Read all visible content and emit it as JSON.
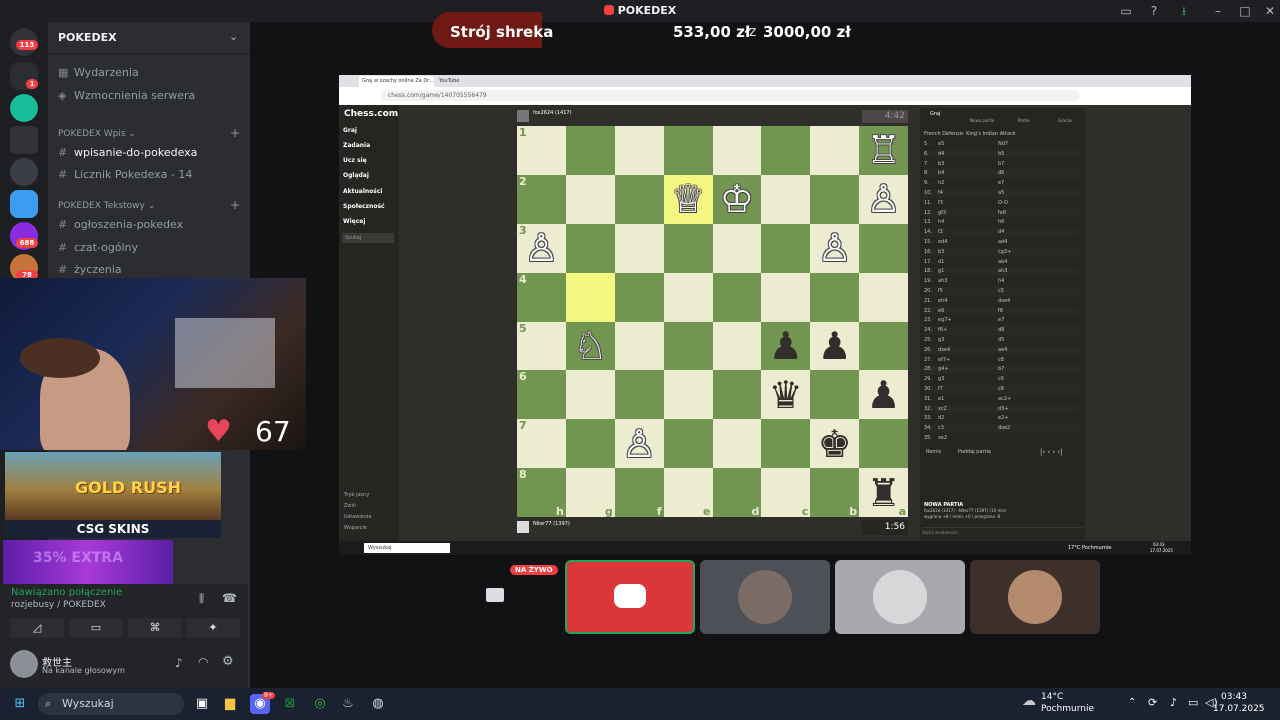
{
  "app": {
    "title": "POKEDEX"
  },
  "server": {
    "name": "POKEDEX"
  },
  "rail": {
    "badges": [
      "113",
      "1",
      "688",
      "78"
    ]
  },
  "channels": {
    "top": [
      {
        "label": "Wydarzenia",
        "icon": "calendar-icon"
      },
      {
        "label": "Wzmocnienia serwera",
        "icon": "boost-icon"
      }
    ],
    "categories": [
      {
        "label": "POKEDEX Wpis",
        "items": [
          {
            "label": "wpisanie-do-pokedexa",
            "active": true
          },
          {
            "label": "Licznik Pokedexa - 14"
          }
        ]
      },
      {
        "label": "POKEDEX Tekstowy",
        "items": [
          {
            "label": "ogłoszenia-pokedex"
          },
          {
            "label": "czat-ogólny"
          },
          {
            "label": "życzenia"
          }
        ]
      }
    ]
  },
  "donation": {
    "label": "Strój shreka",
    "current": "533,00 zł",
    "sep": "z",
    "goal": "3000,00 zł"
  },
  "heart_rate": "67",
  "ads": {
    "game": "GOLD RUSH",
    "sponsor": "CSG SKINS",
    "promo": "35% EXTRA"
  },
  "voice": {
    "status": "Nawiązano połączenie",
    "channel": "rozjebusy / POKEDEX",
    "user_name": "救世主",
    "user_status": "Na kanale głosowym"
  },
  "live_badge": "NA ŻYWO",
  "browser": {
    "tabs": [
      "Graj w szachy online Za Dr...",
      "YouTube"
    ],
    "url": "chess.com/game/140705556479"
  },
  "chess": {
    "brand": "Chess.com",
    "nav": [
      "Graj",
      "Zadania",
      "Ucz się",
      "Oglądaj",
      "Aktualności",
      "Społeczność",
      "Więcej"
    ],
    "nav_search": "Szukaj",
    "nav_bottom": [
      "Tryb jasny",
      "Zwiń",
      "Ustawienia",
      "Wsparcie"
    ],
    "top_player": "fox2624 (1417)",
    "top_clock": "4:42",
    "bottom_player": "Niter77 (1397)",
    "bottom_clock": "1:56",
    "panel_tabs": [
      "Graj",
      "Nowa partia",
      "Partie",
      "Gracze"
    ],
    "opening": "French Defense: King's Indian Attack",
    "moves": [
      [
        "5.",
        "e5",
        "Nd7"
      ],
      [
        "6.",
        "d4",
        "b5"
      ],
      [
        "7.",
        "b3",
        "b7"
      ],
      [
        "8.",
        "b4",
        "d6"
      ],
      [
        "9.",
        "h2",
        "e7"
      ],
      [
        "10.",
        "f4",
        "a5"
      ],
      [
        "11.",
        "f3",
        "O-O"
      ],
      [
        "12.",
        "gf3",
        "fe8"
      ],
      [
        "13.",
        "h4",
        "h6"
      ],
      [
        "14.",
        "f2",
        "d4"
      ],
      [
        "15.",
        "ed4",
        "ad4"
      ],
      [
        "16.",
        "b3",
        "cg3+"
      ],
      [
        "17.",
        "d1",
        "ab4"
      ],
      [
        "18.",
        "g1",
        "ah3"
      ],
      [
        "19.",
        "ah3",
        "h4"
      ],
      [
        "20.",
        "f5",
        "c5"
      ],
      [
        "21.",
        "eh4",
        "dxe4"
      ],
      [
        "22.",
        "e6",
        "f8"
      ],
      [
        "23.",
        "eg7+",
        "e7"
      ],
      [
        "24.",
        "f6+",
        "d8"
      ],
      [
        "25.",
        "g3",
        "d5"
      ],
      [
        "26.",
        "dxe4",
        "ae4"
      ],
      [
        "27.",
        "ef7+",
        "c8"
      ],
      [
        "28.",
        "g4+",
        "b7"
      ],
      [
        "29.",
        "g3",
        "c6"
      ],
      [
        "30.",
        "f7",
        "c8"
      ],
      [
        "31.",
        "e1",
        "ac2+"
      ],
      [
        "32.",
        "xc2",
        "d3+"
      ],
      [
        "33.",
        "d2",
        "e2+"
      ],
      [
        "34.",
        "c3",
        "dxe2"
      ],
      [
        "35.",
        "xe2",
        ""
      ]
    ],
    "panel_actions": [
      "Remis",
      "Poddaj partię"
    ],
    "new_game_title": "NOWA PARTIA",
    "new_game_detail": "fox2624 (1417) - Niter77 (1397) (10 min)",
    "new_game_odds": "wygrana +8 / remis +0 / przegrana -8",
    "chat_placeholder": "Wyślij wiadomość...",
    "board": [
      [
        null,
        null,
        null,
        null,
        null,
        null,
        null,
        "wR"
      ],
      [
        null,
        null,
        null,
        "wQ",
        "wK",
        null,
        null,
        "wP"
      ],
      [
        "wP",
        null,
        null,
        null,
        null,
        null,
        "wP",
        null
      ],
      [
        null,
        null,
        null,
        null,
        null,
        null,
        null,
        null
      ],
      [
        null,
        "wN",
        null,
        null,
        null,
        "bP",
        "bP",
        null
      ],
      [
        null,
        null,
        null,
        null,
        null,
        "bQ",
        null,
        "bP"
      ],
      [
        null,
        null,
        "wP",
        null,
        null,
        null,
        "bK",
        null
      ],
      [
        null,
        null,
        null,
        null,
        null,
        null,
        null,
        "bR"
      ]
    ],
    "ranks": [
      "1",
      "2",
      "3",
      "4",
      "5",
      "6",
      "7",
      "8"
    ],
    "files": [
      "h",
      "g",
      "f",
      "e",
      "d",
      "c",
      "b",
      "a"
    ],
    "highlights": [
      [
        1,
        3
      ],
      [
        3,
        1
      ]
    ],
    "inner_taskbar_search": "Wyszukaj",
    "inner_weather": "17°C Pochmurnie",
    "inner_clock_time": "03:43",
    "inner_clock_date": "17.07.2025"
  },
  "taskbar": {
    "search": "Wyszukaj",
    "weather_temp": "14°C",
    "weather_desc": "Pochmurnie",
    "time": "03:43",
    "date": "17.07.2025",
    "discord_badge": "9+"
  },
  "colors": {
    "accent": "#5865f2",
    "live": "#f23f43",
    "board_light": "#ebecd0",
    "board_dark": "#739552",
    "heart": "#e8455c"
  }
}
